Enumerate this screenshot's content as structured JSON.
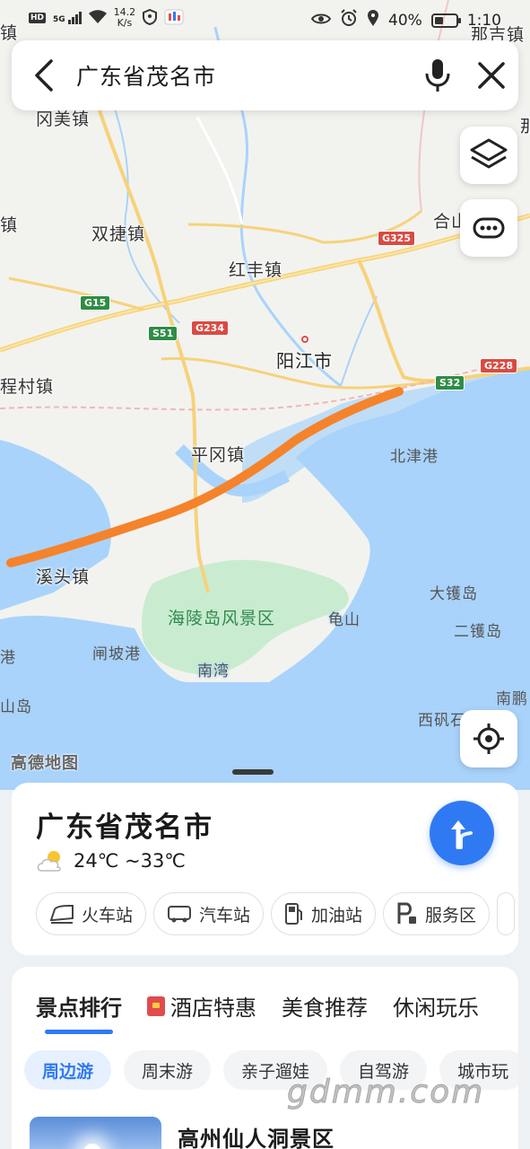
{
  "status_bar": {
    "net_badge": "HD",
    "signal_label": "5G",
    "net_speed_value": "14.2",
    "net_speed_unit": "K/s",
    "battery_percent": "40%",
    "battery_level": 0.4,
    "time": "1:10"
  },
  "search": {
    "query": "广东省茂名市"
  },
  "map": {
    "place_labels": {
      "top_left_edge": "镇",
      "top_right_edge": "那吉镇",
      "gangmei": "冈美镇",
      "left_edge_1": "镇",
      "shuangjie": "双捷镇",
      "hongfeng": "红丰镇",
      "hekou": "合山",
      "yangjiang": "阳江市",
      "chengcun": "程村镇",
      "pinggang": "平冈镇",
      "beijin": "北津港",
      "xitou": "溪头镇",
      "hailing": "海陵岛风景区",
      "guishan": "龟山",
      "dajiao": "大镬岛",
      "erjiao": "二镬岛",
      "zhapo": "闸坡港",
      "nanwan": "南湾",
      "left_gang": "港",
      "left_dao": "山岛",
      "nanpeng": "南鹏",
      "xifan": "西矾石",
      "far_right": "那"
    },
    "road_badges": {
      "g325": "G325",
      "g15": "G15",
      "s51": "S51",
      "g234": "G234",
      "g228": "G228",
      "s32": "S32"
    },
    "logo_text": "高德地图"
  },
  "place_card": {
    "title": "广东省茂名市",
    "weather": "24℃ ~33℃",
    "chips": [
      {
        "label": "火车站",
        "icon": "train-icon"
      },
      {
        "label": "汽车站",
        "icon": "bus-icon"
      },
      {
        "label": "加油站",
        "icon": "gas-station-icon"
      },
      {
        "label": "服务区",
        "icon": "service-area-icon"
      }
    ]
  },
  "recommend": {
    "tabs": [
      "景点排行",
      "酒店特惠",
      "美食推荐",
      "休闲玩乐"
    ],
    "pills": [
      "周边游",
      "周末游",
      "亲子遛娃",
      "自驾游",
      "城市玩"
    ],
    "first_poi": "高州仙人洞景区"
  },
  "watermark": "gdmm.com",
  "colors": {
    "accent": "#2f7af3",
    "route_line": "#f5832b",
    "sea": "#a9d3fb",
    "island_green": "#c9ecd0"
  }
}
